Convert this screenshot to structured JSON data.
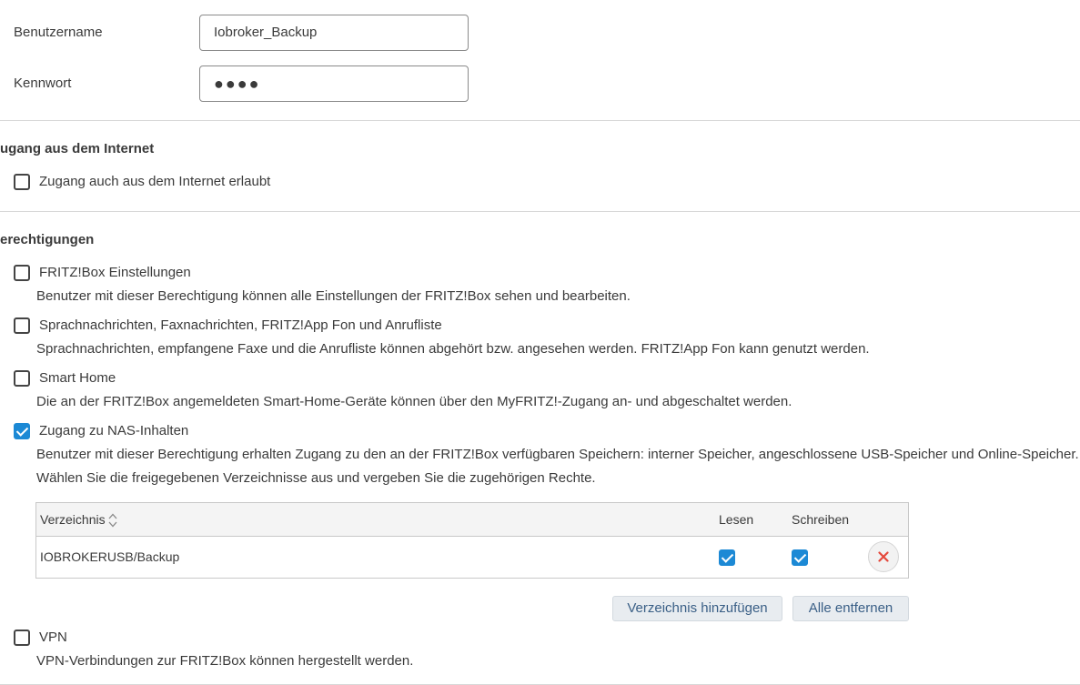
{
  "fields": {
    "username_label": "Benutzername",
    "username_value": "Iobroker_Backup",
    "password_label": "Kennwort",
    "password_value": "●●●●"
  },
  "internet": {
    "title": "ugang aus dem Internet",
    "option_label": "Zugang auch aus dem Internet erlaubt",
    "option_checked": false
  },
  "permissions": {
    "title": "erechtigungen",
    "items": [
      {
        "label": "FRITZ!Box Einstellungen",
        "checked": false,
        "desc": "Benutzer mit dieser Berechtigung können alle Einstellungen der FRITZ!Box sehen und bearbeiten."
      },
      {
        "label": "Sprachnachrichten, Faxnachrichten, FRITZ!App Fon und Anrufliste",
        "checked": false,
        "desc": "Sprachnachrichten, empfangene Faxe und die Anrufliste können abgehört bzw. angesehen werden. FRITZ!App Fon kann genutzt werden."
      },
      {
        "label": "Smart Home",
        "checked": false,
        "desc": "Die an der FRITZ!Box angemeldeten Smart-Home-Geräte können über den MyFRITZ!-Zugang an- und abgeschaltet werden."
      },
      {
        "label": "Zugang zu NAS-Inhalten",
        "checked": true,
        "desc": "Benutzer mit dieser Berechtigung erhalten Zugang zu den an der FRITZ!Box verfügbaren Speichern: interner Speicher, angeschlossene USB-Speicher und Online-Speicher.",
        "desc2": "Wählen Sie die freigegebenen Verzeichnisse aus und vergeben Sie die zugehörigen Rechte."
      },
      {
        "label": "VPN",
        "checked": false,
        "desc": "VPN-Verbindungen zur FRITZ!Box können hergestellt werden."
      }
    ]
  },
  "nas_table": {
    "headers": {
      "directory": "Verzeichnis",
      "read": "Lesen",
      "write": "Schreiben"
    },
    "rows": [
      {
        "directory": "IOBROKERUSB/Backup",
        "read": true,
        "write": true
      }
    ]
  },
  "buttons": {
    "add_directory": "Verzeichnis hinzufügen",
    "remove_all": "Alle entfernen"
  },
  "colors": {
    "accent": "#1c89d5",
    "delete": "#e5483b",
    "button_text": "#3a5f86"
  }
}
